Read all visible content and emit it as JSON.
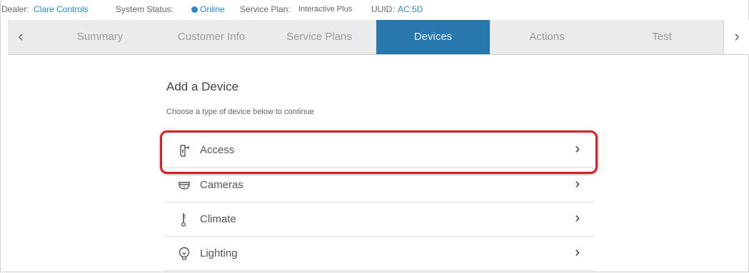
{
  "infobar": {
    "dealer_label": "Dealer:",
    "dealer_value": "Clare Controls",
    "status_label": "System Status:",
    "status_value": "Online",
    "plan_label": "Service Plan:",
    "plan_value": "Interactive Plus",
    "uuid_label": "UUID:",
    "uuid_value": "AC:5D"
  },
  "tabs": {
    "prev_arrow": "‹",
    "next_arrow": "›",
    "items": [
      {
        "label": "Summary"
      },
      {
        "label": "Customer Info"
      },
      {
        "label": "Service Plans"
      },
      {
        "label": "Devices"
      },
      {
        "label": "Actions"
      },
      {
        "label": "Test"
      }
    ],
    "active": "Devices"
  },
  "main": {
    "heading": "Add a Device",
    "subtext": "Choose a type of device below to continue",
    "devices": [
      {
        "label": "Access",
        "icon": "lock-icon",
        "chevron": "›"
      },
      {
        "label": "Cameras",
        "icon": "camera-icon",
        "chevron": "›"
      },
      {
        "label": "Climate",
        "icon": "thermometer-icon",
        "chevron": "›"
      },
      {
        "label": "Lighting",
        "icon": "lightbulb-icon",
        "chevron": "›"
      }
    ]
  },
  "colors": {
    "accent": "#2878ad",
    "link": "#2a8ad0",
    "highlight": "#d81e26"
  }
}
